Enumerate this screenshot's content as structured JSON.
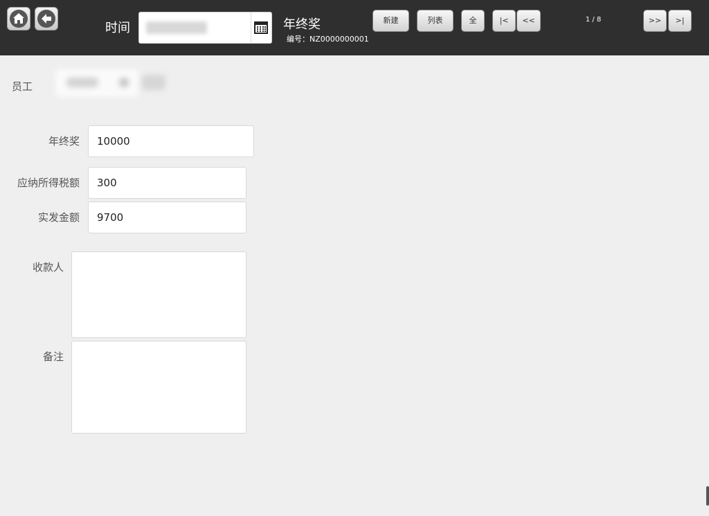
{
  "toolbar": {
    "time_label": "时间",
    "date_value": "",
    "title": "年终奖",
    "doc_number": "编号：NZ0000000001",
    "new_label": "新建",
    "list_label": "列表",
    "all_label": "全",
    "first_label": "|<",
    "prev_label": "<<",
    "page_indicator": "1 / 8",
    "next_label": ">>",
    "last_label": ">|"
  },
  "employee": {
    "label": "员工",
    "value": ""
  },
  "form": {
    "bonus_label": "年终奖",
    "bonus_value": "10000",
    "tax_label": "应纳所得税额",
    "tax_value": "300",
    "actual_label": "实发金额",
    "actual_value": "9700",
    "payee_label": "收款人",
    "payee_value": "",
    "remark_label": "备注",
    "remark_value": ""
  },
  "icons": {
    "home": "home-icon",
    "back": "back-arrow-icon",
    "calendar": "calendar-icon"
  },
  "colors": {
    "toolbar_bg": "#2f2f2f",
    "page_bg": "#efefef"
  }
}
